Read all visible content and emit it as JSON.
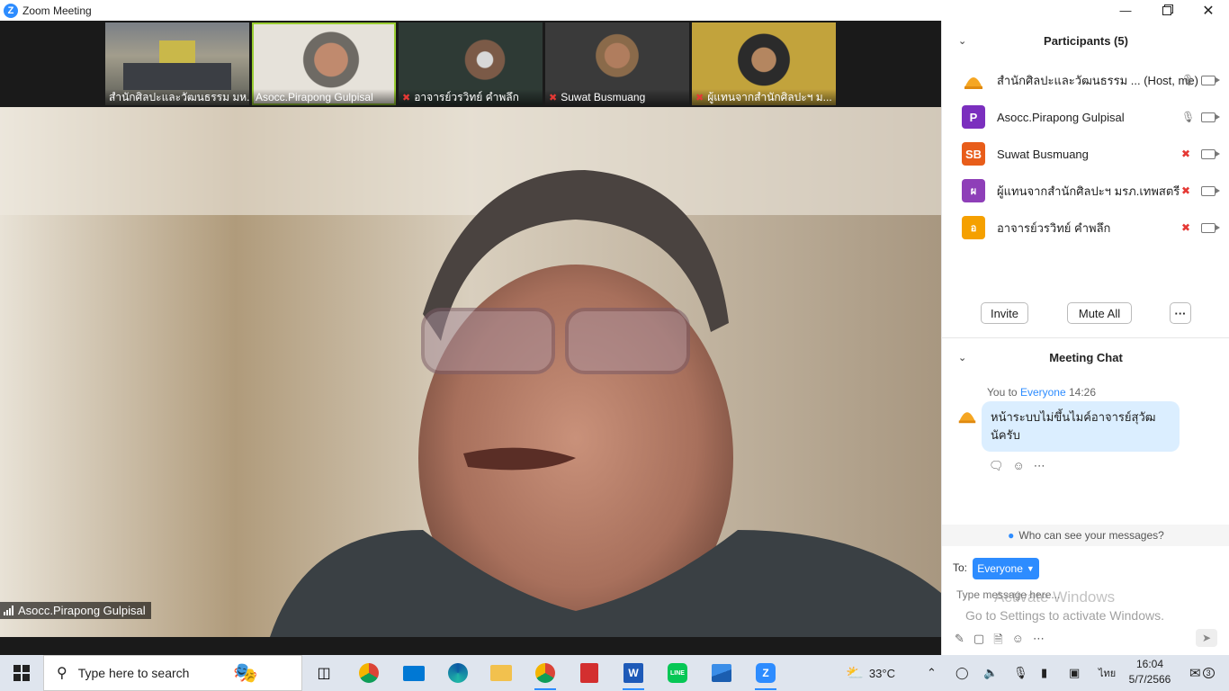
{
  "window": {
    "title": "Zoom Meeting",
    "controls": [
      "minimize-icon",
      "maximize-icon",
      "close-icon"
    ]
  },
  "gallery": [
    {
      "name": "สำนักศิลปะและวัฒนธรรม มห...",
      "muted": false,
      "active": false
    },
    {
      "name": "Asocc.Pirapong Gulpisal",
      "muted": false,
      "active": true
    },
    {
      "name": "อาจารย์วรวิทย์ คำพลึก",
      "muted": true,
      "active": false
    },
    {
      "name": "Suwat Busmuang",
      "muted": true,
      "active": false
    },
    {
      "name": "ผู้แทนจากสำนักศิลปะฯ  ม...",
      "muted": true,
      "active": false
    }
  ],
  "main_video": {
    "speaker": "Asocc.Pirapong Gulpisal"
  },
  "participants": {
    "header": "Participants (5)",
    "list": [
      {
        "initial": "",
        "color": "#f5a623",
        "name": "สำนักศิลปะและวัฒนธรรม ... (Host, me)",
        "muted": false
      },
      {
        "initial": "P",
        "color": "#7b2fbe",
        "name": "Asocc.Pirapong Gulpisal",
        "muted": false
      },
      {
        "initial": "SB",
        "color": "#e85d1a",
        "name": "Suwat Busmuang",
        "muted": true
      },
      {
        "initial": "ผ",
        "color": "#8e3fb8",
        "name": "ผู้แทนจากสำนักศิลปะฯ  มรภ.เทพสตรี",
        "muted": true
      },
      {
        "initial": "อ",
        "color": "#f5a000",
        "name": "อาจารย์วรวิทย์ คำพลึก",
        "muted": true
      }
    ],
    "invite_label": "Invite",
    "mute_all_label": "Mute All",
    "more_label": "···"
  },
  "chat": {
    "header": "Meeting Chat",
    "message": {
      "from": "You to",
      "to": "Everyone",
      "time": "14:26",
      "text": "หน้าระบบไม่ขึ้นไมค์อาจารย์สุวัฒ นัครับ"
    },
    "who_can_see": "Who can see your messages?",
    "to_label": "To:",
    "recipient": "Everyone",
    "placeholder": "Type message here...",
    "activate_title": "Activate Windows",
    "activate_sub": "Go to Settings to activate Windows."
  },
  "taskbar": {
    "search_placeholder": "Type here to search",
    "weather": "33°C",
    "lang": "ไทย",
    "time": "16:04",
    "date": "5/7/2566",
    "notif_count": "3"
  }
}
